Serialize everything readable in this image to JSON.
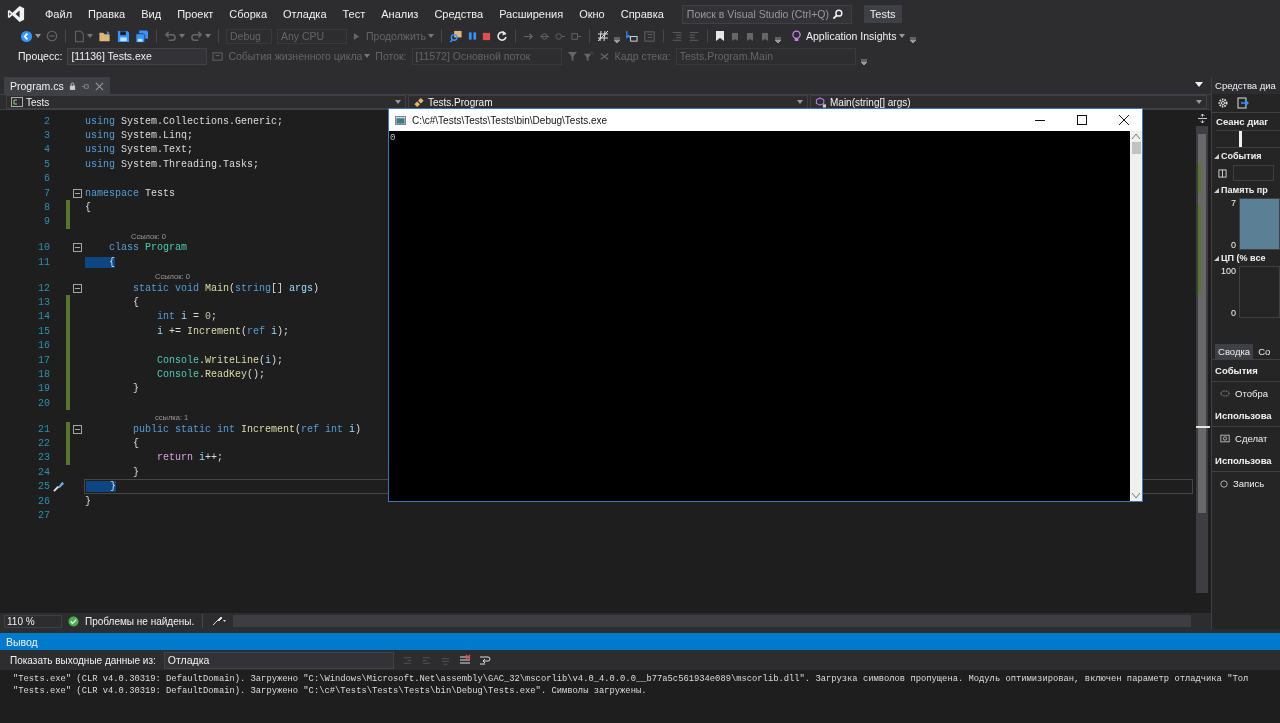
{
  "menu": {
    "items": [
      "Файл",
      "Правка",
      "Вид",
      "Проект",
      "Сборка",
      "Отладка",
      "Тест",
      "Анализ",
      "Средства",
      "Расширения",
      "Окно",
      "Справка"
    ]
  },
  "search": {
    "placeholder": "Поиск в Visual Studio (Ctrl+Q)"
  },
  "solution_title": "Tests",
  "toolbar": {
    "configuration": {
      "value": "Debug",
      "disabled": true
    },
    "platform": {
      "value": "Any CPU",
      "disabled": true
    },
    "continue": {
      "label": "Продолжить",
      "disabled": true
    },
    "insights": "Application Insights"
  },
  "debug_location": {
    "process_label": "Процесс:",
    "process": {
      "value": "[11136] Tests.exe",
      "disabled": false
    },
    "lifecycle": {
      "label": "События жизненного цикла",
      "disabled": true
    },
    "thread_label": "Поток:",
    "thread": {
      "value": "[11572] Основной поток",
      "disabled": true
    },
    "frame_label": "Кадр стека:",
    "frame": {
      "value": "Tests.Program.Main",
      "disabled": true
    }
  },
  "tabs": [
    {
      "label": "Program.cs",
      "selected": true
    }
  ],
  "navbar": {
    "project": "Tests",
    "type": "Tests.Program",
    "member": "Main(string[] args)"
  },
  "editor": {
    "lines": [
      {
        "kind": "code",
        "number": "2",
        "changed": false,
        "foldable": false,
        "tokens": [
          {
            "text": "using",
            "kind": "keyword"
          },
          {
            "text": " System.Collections.Generic;",
            "kind": "plain"
          }
        ]
      },
      {
        "kind": "code",
        "number": "3",
        "changed": false,
        "foldable": false,
        "tokens": [
          {
            "text": "using",
            "kind": "keyword"
          },
          {
            "text": " System.Linq;",
            "kind": "plain"
          }
        ]
      },
      {
        "kind": "code",
        "number": "4",
        "changed": false,
        "foldable": false,
        "tokens": [
          {
            "text": "using",
            "kind": "keyword"
          },
          {
            "text": " System.Text;",
            "kind": "plain"
          }
        ]
      },
      {
        "kind": "code",
        "number": "5",
        "changed": false,
        "foldable": false,
        "tokens": [
          {
            "text": "using",
            "kind": "keyword"
          },
          {
            "text": " System.Threading.Tasks;",
            "kind": "plain"
          }
        ]
      },
      {
        "kind": "code",
        "number": "6",
        "changed": false,
        "foldable": false
      },
      {
        "kind": "code",
        "number": "7",
        "changed": false,
        "foldable": true,
        "tokens": [
          {
            "text": "namespace",
            "kind": "keyword"
          },
          {
            "text": " Tests",
            "kind": "plain"
          }
        ]
      },
      {
        "kind": "code",
        "number": "8",
        "changed": true,
        "foldable": false,
        "tokens": [
          {
            "text": "{",
            "kind": "plain"
          }
        ]
      },
      {
        "kind": "code",
        "number": "9",
        "changed": true,
        "foldable": false
      },
      {
        "kind": "lens",
        "text": "Ссылок: 0"
      },
      {
        "kind": "code",
        "number": "10",
        "changed": false,
        "foldable": true,
        "tokens": [
          {
            "text": "    class",
            "kind": "keyword"
          },
          {
            "text": " Program",
            "kind": "type"
          }
        ]
      },
      {
        "kind": "code",
        "number": "11",
        "changed": false,
        "foldable": false,
        "tokens": [
          {
            "text": "    {",
            "kind": "brace-match"
          }
        ]
      },
      {
        "kind": "lens",
        "text": "Ссылок: 0"
      },
      {
        "kind": "code",
        "number": "12",
        "changed": false,
        "foldable": true,
        "tokens": [
          {
            "text": "        static void",
            "kind": "keyword"
          },
          {
            "text": " Main",
            "kind": "method"
          },
          {
            "text": "(",
            "kind": "plain"
          },
          {
            "text": "string",
            "kind": "keyword"
          },
          {
            "text": "[] ",
            "kind": "plain"
          },
          {
            "text": "args",
            "kind": "param"
          },
          {
            "text": ")",
            "kind": "plain"
          }
        ]
      },
      {
        "kind": "code",
        "number": "13",
        "changed": true,
        "foldable": false,
        "tokens": [
          {
            "text": "        {",
            "kind": "plain"
          }
        ]
      },
      {
        "kind": "code",
        "number": "14",
        "changed": true,
        "foldable": false,
        "tokens": [
          {
            "text": "            int ",
            "kind": "keyword"
          },
          {
            "text": "i",
            "kind": "param"
          },
          {
            "text": " = ",
            "kind": "plain"
          },
          {
            "text": "0",
            "kind": "number"
          },
          {
            "text": ";",
            "kind": "plain"
          }
        ]
      },
      {
        "kind": "code",
        "number": "15",
        "changed": true,
        "foldable": false,
        "tokens": [
          {
            "text": "            i",
            "kind": "param"
          },
          {
            "text": " += ",
            "kind": "plain"
          },
          {
            "text": "Increment",
            "kind": "method"
          },
          {
            "text": "(",
            "kind": "plain"
          },
          {
            "text": "ref ",
            "kind": "keyword"
          },
          {
            "text": "i",
            "kind": "param"
          },
          {
            "text": ");",
            "kind": "plain"
          }
        ]
      },
      {
        "kind": "code",
        "number": "16",
        "changed": true,
        "foldable": false
      },
      {
        "kind": "code",
        "number": "17",
        "changed": true,
        "foldable": false,
        "tokens": [
          {
            "text": "            Console",
            "kind": "type"
          },
          {
            "text": ".",
            "kind": "plain"
          },
          {
            "text": "WriteLine",
            "kind": "method"
          },
          {
            "text": "(",
            "kind": "plain"
          },
          {
            "text": "i",
            "kind": "param"
          },
          {
            "text": ");",
            "kind": "plain"
          }
        ]
      },
      {
        "kind": "code",
        "number": "18",
        "changed": true,
        "foldable": false,
        "tokens": [
          {
            "text": "            Console",
            "kind": "type"
          },
          {
            "text": ".",
            "kind": "plain"
          },
          {
            "text": "ReadKey",
            "kind": "method"
          },
          {
            "text": "();",
            "kind": "plain"
          }
        ]
      },
      {
        "kind": "code",
        "number": "19",
        "changed": true,
        "foldable": false,
        "tokens": [
          {
            "text": "        }",
            "kind": "plain"
          }
        ]
      },
      {
        "kind": "code",
        "number": "20",
        "changed": true,
        "foldable": false
      },
      {
        "kind": "lens",
        "text": "ссылка: 1"
      },
      {
        "kind": "code",
        "number": "21",
        "changed": true,
        "foldable": true,
        "tokens": [
          {
            "text": "        public static int ",
            "kind": "keyword"
          },
          {
            "text": "Increment",
            "kind": "method"
          },
          {
            "text": "(",
            "kind": "plain"
          },
          {
            "text": "ref int ",
            "kind": "keyword"
          },
          {
            "text": "i",
            "kind": "param"
          },
          {
            "text": ")",
            "kind": "plain"
          }
        ]
      },
      {
        "kind": "code",
        "number": "22",
        "changed": true,
        "foldable": false,
        "tokens": [
          {
            "text": "        {",
            "kind": "plain"
          }
        ]
      },
      {
        "kind": "code",
        "number": "23",
        "changed": true,
        "foldable": false,
        "tokens": [
          {
            "text": "            return ",
            "kind": "control"
          },
          {
            "text": "i",
            "kind": "param"
          },
          {
            "text": "++;",
            "kind": "plain"
          }
        ]
      },
      {
        "kind": "code",
        "number": "24",
        "changed": false,
        "foldable": false,
        "tokens": [
          {
            "text": "        }",
            "kind": "plain"
          }
        ]
      },
      {
        "kind": "code",
        "number": "25",
        "changed": false,
        "foldable": false,
        "current": true,
        "quick_action": true,
        "tokens": [
          {
            "text": "    }",
            "kind": "brace-match"
          }
        ]
      },
      {
        "kind": "code",
        "number": "26",
        "changed": false,
        "foldable": false,
        "tokens": [
          {
            "text": "}",
            "kind": "plain"
          }
        ]
      },
      {
        "kind": "code",
        "number": "27",
        "changed": false,
        "foldable": false
      }
    ]
  },
  "console_window": {
    "title": "C:\\c#\\Tests\\Tests\\Tests\\bin\\Debug\\Tests.exe",
    "output": "0"
  },
  "editor_status": {
    "zoom": "110 %",
    "issues": "Проблемы не найдены."
  },
  "diagnostics": {
    "title": "Средства диа",
    "session_label": "Сеанс диаг",
    "events_heading": "События",
    "memory_heading": "Память пр",
    "memory_ticks": [
      "7",
      "0"
    ],
    "cpu_heading": "ЦП (% все",
    "cpu_ticks": [
      "100",
      "0"
    ],
    "tabs": [
      {
        "label": "Сводка",
        "selected": true
      },
      {
        "label": "Со",
        "selected": false
      }
    ],
    "summary": [
      {
        "kind": "heading",
        "text": "События"
      },
      {
        "kind": "item",
        "text": "Отобра"
      },
      {
        "kind": "heading",
        "text": "Использова"
      },
      {
        "kind": "item",
        "text": "Сделат"
      },
      {
        "kind": "heading",
        "text": "Использова"
      },
      {
        "kind": "item",
        "text": "Запись"
      }
    ]
  },
  "output": {
    "title": "Вывод",
    "source_label": "Показать выходные данные из:",
    "source": "Отладка",
    "lines": [
      "\"Tests.exe\" (CLR v4.0.30319: DefaultDomain). Загружено \"C:\\Windows\\Microsoft.Net\\assembly\\GAC_32\\mscorlib\\v4.0_4.0.0.0__b77a5c561934e089\\mscorlib.dll\". Загрузка символов пропущена. Модуль оптимизирован, включен параметр отладчика \"Тол",
      "\"Tests.exe\" (CLR v4.0.30319: DefaultDomain). Загружено \"C:\\c#\\Tests\\Tests\\Tests\\bin\\Debug\\Tests.exe\". Символы загружены."
    ]
  }
}
